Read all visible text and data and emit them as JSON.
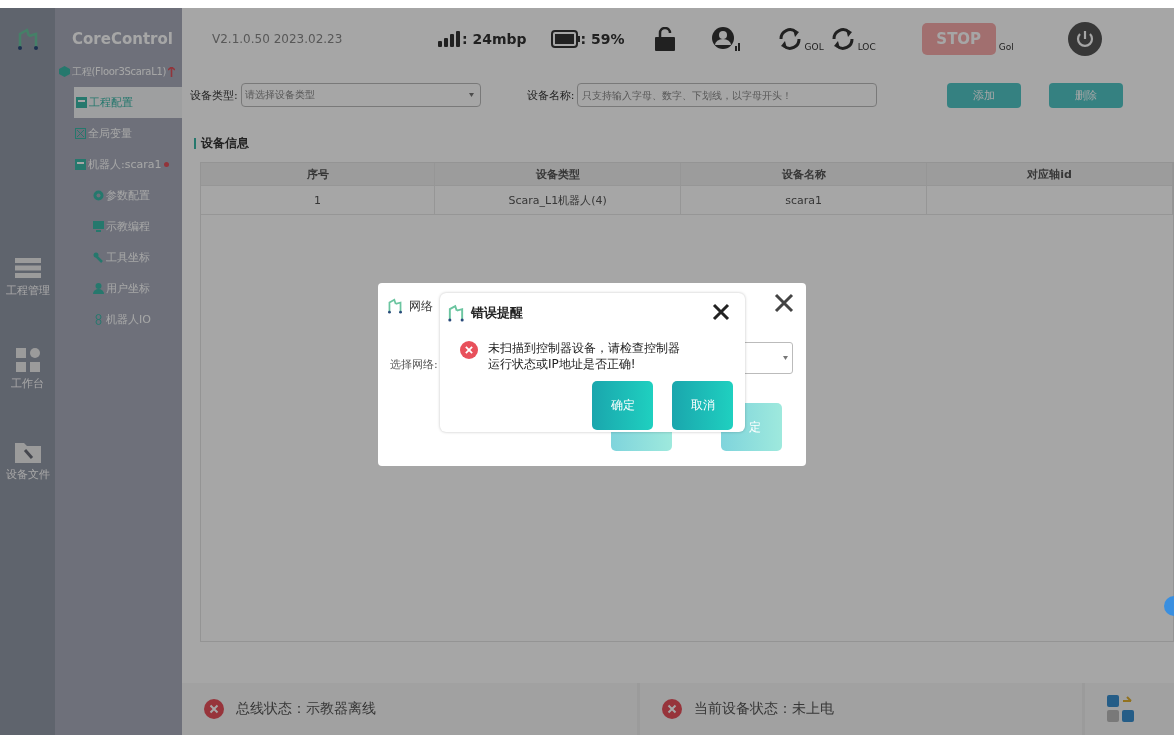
{
  "app": {
    "name": "CoreControl"
  },
  "rail": [
    {
      "label": "工程管理",
      "kind": "list"
    },
    {
      "label": "工作台",
      "kind": "grid"
    },
    {
      "label": "设备文件",
      "kind": "folder"
    }
  ],
  "tree": {
    "label": "工程(Floor3ScaraL1)",
    "alert": true,
    "children": [
      {
        "label": "工程配置",
        "kind": "config",
        "selected": true,
        "alert": false
      },
      {
        "label": "全局变量",
        "kind": "vars",
        "selected": false,
        "alert": false
      },
      {
        "label": "机器人:scara1",
        "kind": "config",
        "selected": false,
        "alert": true,
        "children": [
          {
            "label": "参数配置",
            "kind": "gear",
            "selected": false,
            "alert": false
          },
          {
            "label": "示教编程",
            "kind": "screen",
            "selected": false,
            "alert": false
          },
          {
            "label": "工具坐标",
            "kind": "wrench",
            "selected": false,
            "alert": false
          },
          {
            "label": "用户坐标",
            "kind": "user",
            "selected": false,
            "alert": false
          },
          {
            "label": "机器人IO",
            "kind": "io",
            "selected": false,
            "alert": false
          }
        ]
      }
    ]
  },
  "topbar": {
    "version": "V2.1.0.50  2023.02.23",
    "signal": ": 24mbp",
    "battery": ": 59%",
    "sync": [
      {
        "label": "GOL"
      },
      {
        "label": "LOC"
      }
    ],
    "stop": "STOP",
    "stop_mode": "Gol"
  },
  "filter": {
    "type_label": "设备类型:",
    "type_placeholder": "请选择设备类型",
    "name_label": "设备名称:",
    "name_placeholder": "只支持输入字母、数字、下划线，以字母开头！",
    "buttons": [
      "添加",
      "删除"
    ]
  },
  "section_title": "设备信息",
  "table": {
    "columns": [
      "序号",
      "设备类型",
      "设备名称",
      "对应轴id"
    ],
    "rows": [
      [
        "1",
        "Scara_L1机器人(4)",
        "scara1"
      ]
    ]
  },
  "status_bar": [
    {
      "text": "总线状态：示教器离线",
      "error": true
    },
    {
      "text": "当前设备状态：未上电",
      "error": true
    }
  ],
  "network_dialog": {
    "title": "网络",
    "label": "选择网络:",
    "button": "定"
  },
  "error_dialog": {
    "title": "错误提醒",
    "message": "未扫描到控制器设备，请检查控制器运行状态或IP地址是否正确!",
    "buttons": [
      "确定",
      "取消"
    ]
  }
}
